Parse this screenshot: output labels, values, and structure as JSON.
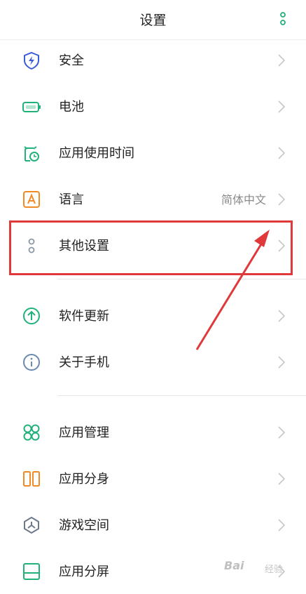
{
  "header": {
    "title": "设置"
  },
  "items": [
    {
      "label": "安全",
      "icon": "shield-icon",
      "color": "#3a5bdb"
    },
    {
      "label": "电池",
      "icon": "battery-icon",
      "color": "#21b27a"
    },
    {
      "label": "应用使用时间",
      "icon": "app-usage-time-icon",
      "color": "#21b27a"
    },
    {
      "label": "语言",
      "value": "简体中文",
      "icon": "language-icon",
      "color": "#f08a24"
    },
    {
      "label": "其他设置",
      "icon": "other-settings-icon",
      "color": "#8a98a8"
    },
    {
      "label": "软件更新",
      "icon": "software-update-icon",
      "color": "#21b27a"
    },
    {
      "label": "关于手机",
      "icon": "about-phone-icon",
      "color": "#6b8ab0"
    },
    {
      "label": "应用管理",
      "icon": "app-management-icon",
      "color": "#21b27a"
    },
    {
      "label": "应用分身",
      "icon": "app-clone-icon",
      "color": "#f08a24"
    },
    {
      "label": "游戏空间",
      "icon": "game-space-icon",
      "color": "#6b7b8c"
    },
    {
      "label": "应用分屏",
      "icon": "split-screen-icon",
      "color": "#21b27a"
    }
  ],
  "annotation": {
    "highlight_color": "#e0393b"
  },
  "watermark": {
    "text": "Bai",
    "sub": "经验"
  }
}
